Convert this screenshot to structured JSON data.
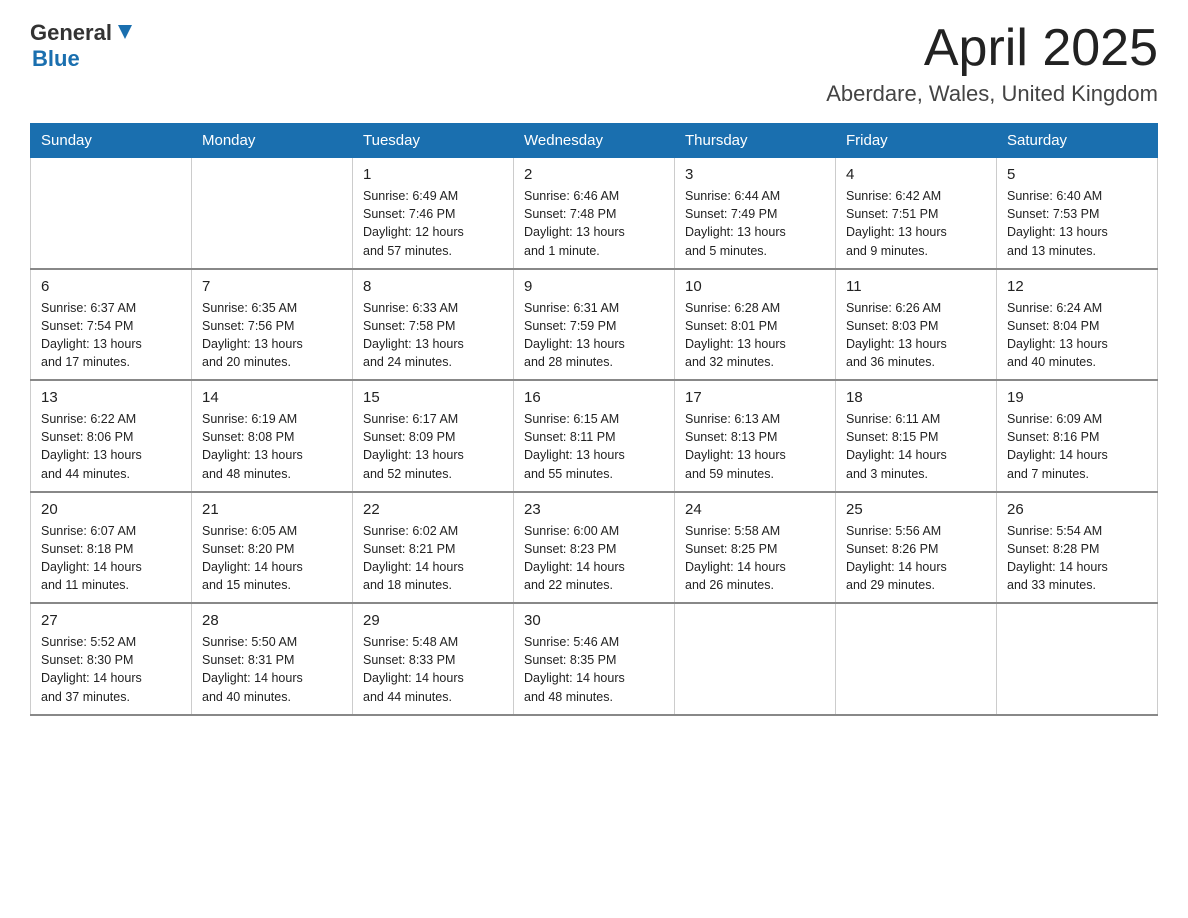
{
  "header": {
    "logo_general": "General",
    "logo_blue": "Blue",
    "month": "April 2025",
    "location": "Aberdare, Wales, United Kingdom"
  },
  "columns": [
    "Sunday",
    "Monday",
    "Tuesday",
    "Wednesday",
    "Thursday",
    "Friday",
    "Saturday"
  ],
  "weeks": [
    [
      {
        "day": "",
        "info": ""
      },
      {
        "day": "",
        "info": ""
      },
      {
        "day": "1",
        "info": "Sunrise: 6:49 AM\nSunset: 7:46 PM\nDaylight: 12 hours\nand 57 minutes."
      },
      {
        "day": "2",
        "info": "Sunrise: 6:46 AM\nSunset: 7:48 PM\nDaylight: 13 hours\nand 1 minute."
      },
      {
        "day": "3",
        "info": "Sunrise: 6:44 AM\nSunset: 7:49 PM\nDaylight: 13 hours\nand 5 minutes."
      },
      {
        "day": "4",
        "info": "Sunrise: 6:42 AM\nSunset: 7:51 PM\nDaylight: 13 hours\nand 9 minutes."
      },
      {
        "day": "5",
        "info": "Sunrise: 6:40 AM\nSunset: 7:53 PM\nDaylight: 13 hours\nand 13 minutes."
      }
    ],
    [
      {
        "day": "6",
        "info": "Sunrise: 6:37 AM\nSunset: 7:54 PM\nDaylight: 13 hours\nand 17 minutes."
      },
      {
        "day": "7",
        "info": "Sunrise: 6:35 AM\nSunset: 7:56 PM\nDaylight: 13 hours\nand 20 minutes."
      },
      {
        "day": "8",
        "info": "Sunrise: 6:33 AM\nSunset: 7:58 PM\nDaylight: 13 hours\nand 24 minutes."
      },
      {
        "day": "9",
        "info": "Sunrise: 6:31 AM\nSunset: 7:59 PM\nDaylight: 13 hours\nand 28 minutes."
      },
      {
        "day": "10",
        "info": "Sunrise: 6:28 AM\nSunset: 8:01 PM\nDaylight: 13 hours\nand 32 minutes."
      },
      {
        "day": "11",
        "info": "Sunrise: 6:26 AM\nSunset: 8:03 PM\nDaylight: 13 hours\nand 36 minutes."
      },
      {
        "day": "12",
        "info": "Sunrise: 6:24 AM\nSunset: 8:04 PM\nDaylight: 13 hours\nand 40 minutes."
      }
    ],
    [
      {
        "day": "13",
        "info": "Sunrise: 6:22 AM\nSunset: 8:06 PM\nDaylight: 13 hours\nand 44 minutes."
      },
      {
        "day": "14",
        "info": "Sunrise: 6:19 AM\nSunset: 8:08 PM\nDaylight: 13 hours\nand 48 minutes."
      },
      {
        "day": "15",
        "info": "Sunrise: 6:17 AM\nSunset: 8:09 PM\nDaylight: 13 hours\nand 52 minutes."
      },
      {
        "day": "16",
        "info": "Sunrise: 6:15 AM\nSunset: 8:11 PM\nDaylight: 13 hours\nand 55 minutes."
      },
      {
        "day": "17",
        "info": "Sunrise: 6:13 AM\nSunset: 8:13 PM\nDaylight: 13 hours\nand 59 minutes."
      },
      {
        "day": "18",
        "info": "Sunrise: 6:11 AM\nSunset: 8:15 PM\nDaylight: 14 hours\nand 3 minutes."
      },
      {
        "day": "19",
        "info": "Sunrise: 6:09 AM\nSunset: 8:16 PM\nDaylight: 14 hours\nand 7 minutes."
      }
    ],
    [
      {
        "day": "20",
        "info": "Sunrise: 6:07 AM\nSunset: 8:18 PM\nDaylight: 14 hours\nand 11 minutes."
      },
      {
        "day": "21",
        "info": "Sunrise: 6:05 AM\nSunset: 8:20 PM\nDaylight: 14 hours\nand 15 minutes."
      },
      {
        "day": "22",
        "info": "Sunrise: 6:02 AM\nSunset: 8:21 PM\nDaylight: 14 hours\nand 18 minutes."
      },
      {
        "day": "23",
        "info": "Sunrise: 6:00 AM\nSunset: 8:23 PM\nDaylight: 14 hours\nand 22 minutes."
      },
      {
        "day": "24",
        "info": "Sunrise: 5:58 AM\nSunset: 8:25 PM\nDaylight: 14 hours\nand 26 minutes."
      },
      {
        "day": "25",
        "info": "Sunrise: 5:56 AM\nSunset: 8:26 PM\nDaylight: 14 hours\nand 29 minutes."
      },
      {
        "day": "26",
        "info": "Sunrise: 5:54 AM\nSunset: 8:28 PM\nDaylight: 14 hours\nand 33 minutes."
      }
    ],
    [
      {
        "day": "27",
        "info": "Sunrise: 5:52 AM\nSunset: 8:30 PM\nDaylight: 14 hours\nand 37 minutes."
      },
      {
        "day": "28",
        "info": "Sunrise: 5:50 AM\nSunset: 8:31 PM\nDaylight: 14 hours\nand 40 minutes."
      },
      {
        "day": "29",
        "info": "Sunrise: 5:48 AM\nSunset: 8:33 PM\nDaylight: 14 hours\nand 44 minutes."
      },
      {
        "day": "30",
        "info": "Sunrise: 5:46 AM\nSunset: 8:35 PM\nDaylight: 14 hours\nand 48 minutes."
      },
      {
        "day": "",
        "info": ""
      },
      {
        "day": "",
        "info": ""
      },
      {
        "day": "",
        "info": ""
      }
    ]
  ]
}
